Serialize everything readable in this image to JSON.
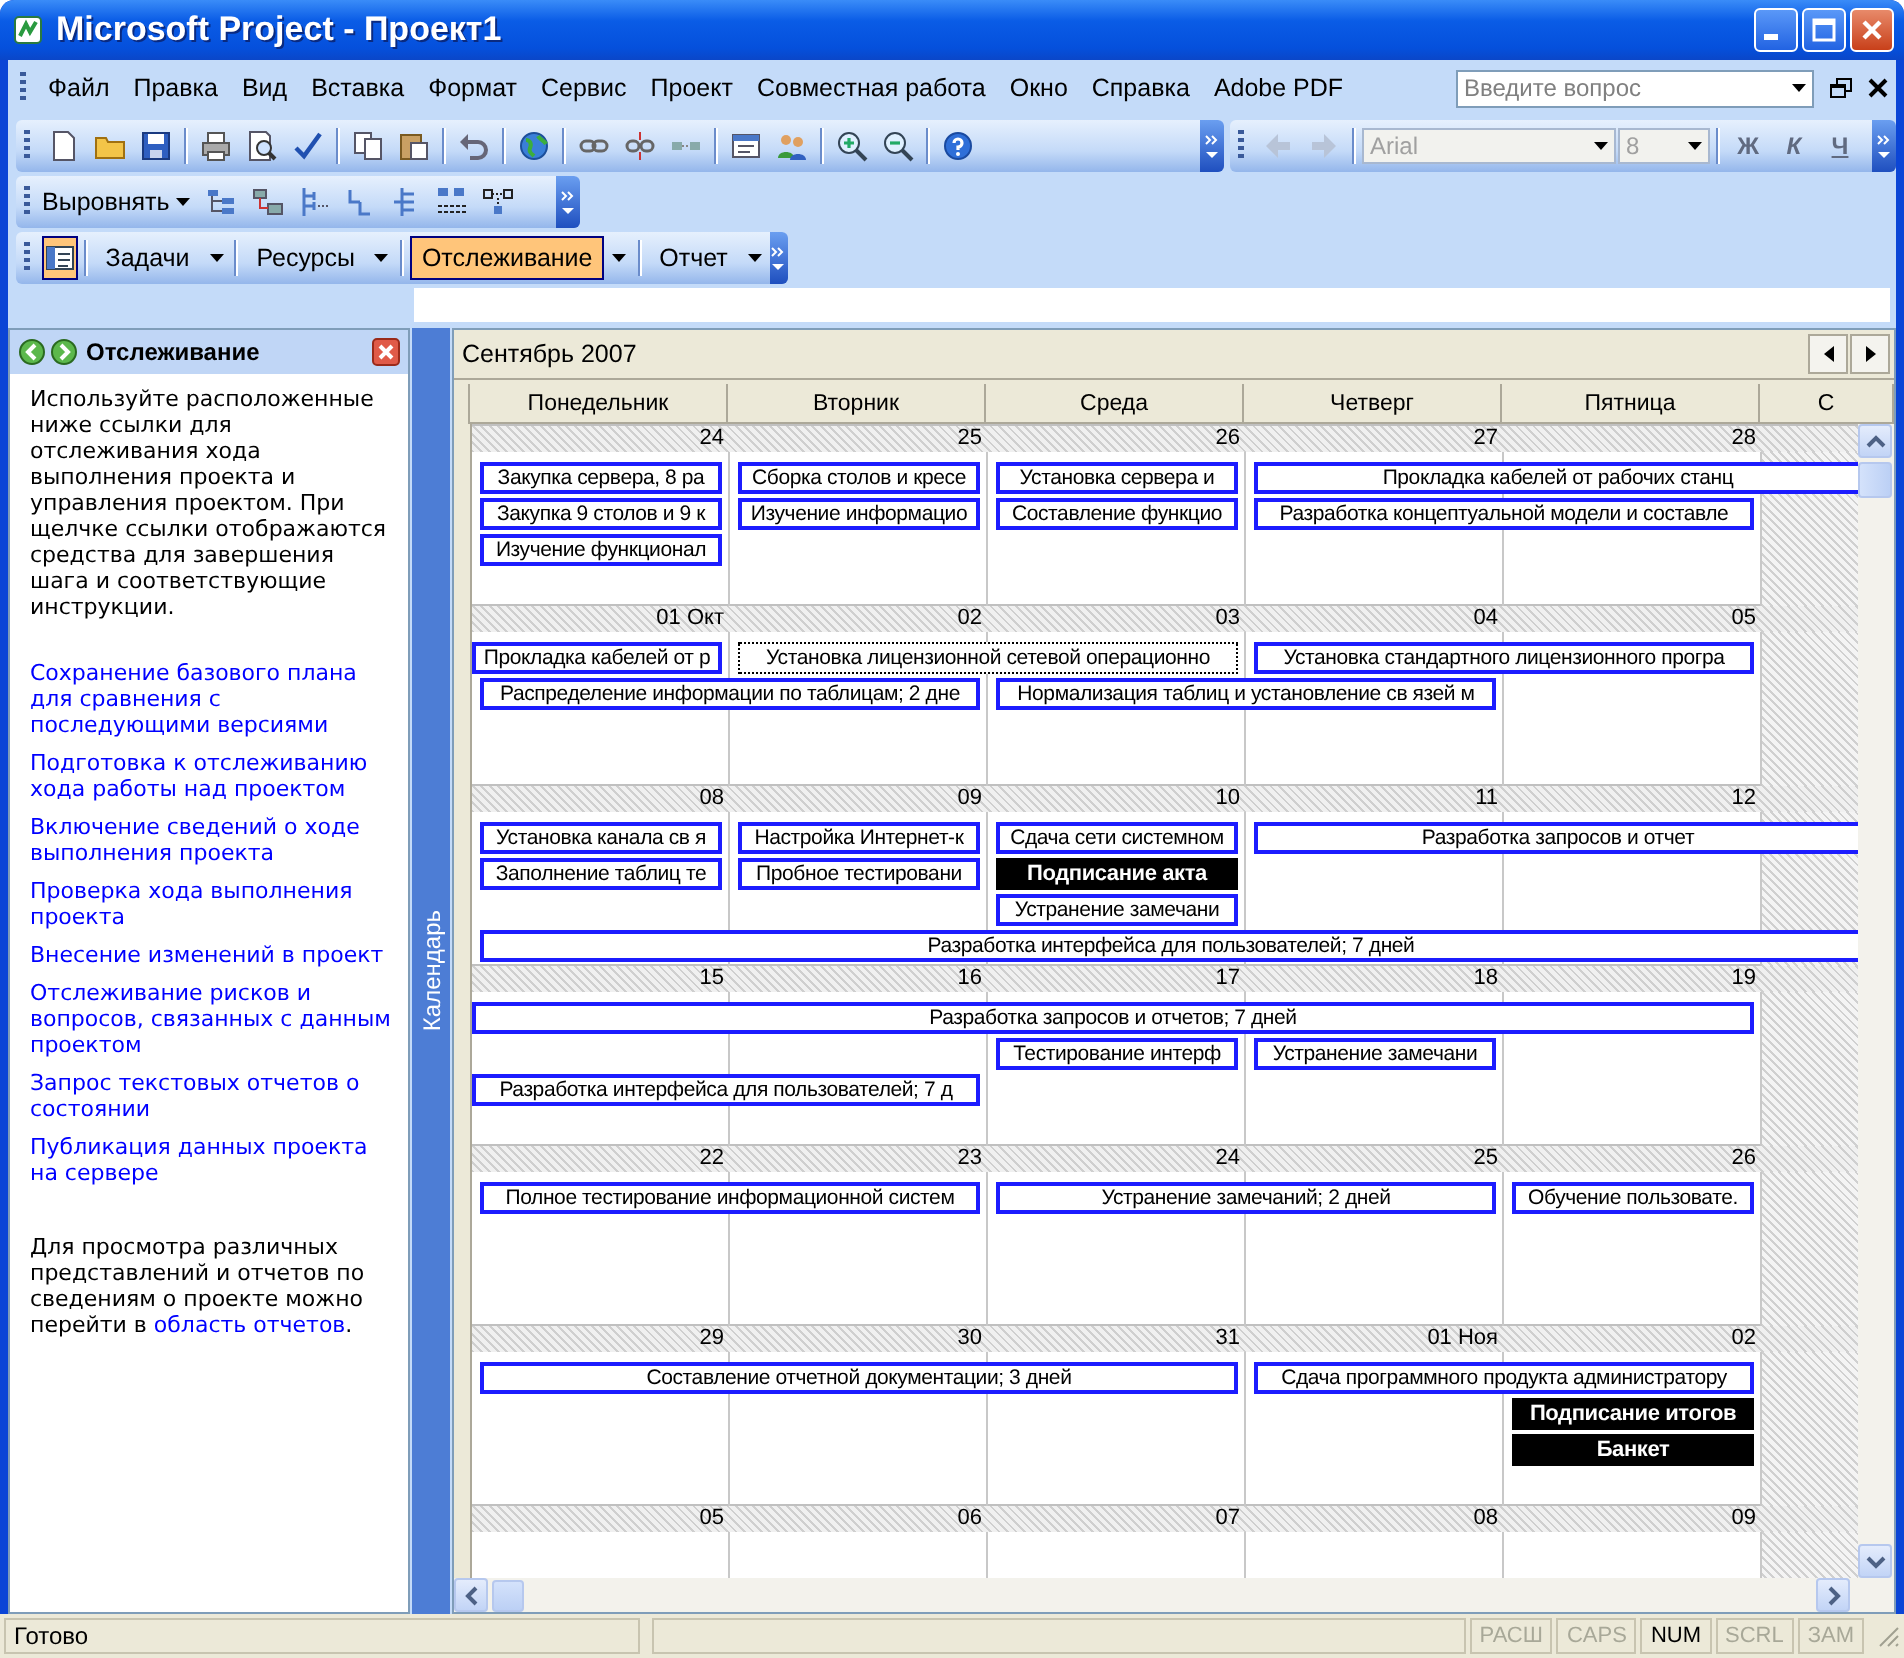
{
  "window": {
    "title": "Microsoft Project - Проект1"
  },
  "menu": [
    "Файл",
    "Правка",
    "Вид",
    "Вставка",
    "Формат",
    "Сервис",
    "Проект",
    "Совместная работа",
    "Окно",
    "Справка",
    "Adobe PDF"
  ],
  "ask_box": {
    "placeholder": "Введите вопрос"
  },
  "format_toolbar": {
    "font": "Arial",
    "size": "8",
    "buttons": [
      "Ж",
      "К",
      "Ч"
    ]
  },
  "align_toolbar": {
    "label": "Выровнять"
  },
  "project_guide": {
    "pane_button": {
      "on": true
    },
    "items": [
      {
        "label": "Задачи",
        "selected": false
      },
      {
        "label": "Ресурсы",
        "selected": false
      },
      {
        "label": "Отслеживание",
        "selected": true
      },
      {
        "label": "Отчет",
        "selected": false
      }
    ]
  },
  "task_pane": {
    "title": "Отслеживание",
    "intro": "Используйте расположенные ниже ссылки для отслеживания хода выполнения проекта и управления проектом. При щелчке ссылки отображаются средства для завершения шага и соответствующие инструкции.",
    "links": [
      "Сохранение базового плана для сравнения с последующими версиями",
      "Подготовка к отслеживанию хода работы над проектом",
      "Включение сведений о ходе выполнения проекта",
      "Проверка хода выполнения проекта",
      "Внесение изменений в проект",
      "Отслеживание рисков и вопросов, связанных с данным проектом",
      "Запрос текстовых отчетов о состоянии",
      "Публикация данных проекта на сервере"
    ],
    "footer": {
      "before": "Для просмотра различных представлений и отчетов по сведениям о проекте можно перейти в ",
      "link": "область отчетов",
      "after": "."
    }
  },
  "view_bar": {
    "label": "Календарь"
  },
  "calendar": {
    "month": "Сентябрь 2007",
    "weekdays": [
      "Понедельник",
      "Вторник",
      "Среда",
      "Четверг",
      "Пятница",
      "С"
    ],
    "weeks": [
      {
        "dates": [
          "24",
          "25",
          "26",
          "27",
          "28"
        ],
        "lanes": [
          [
            {
              "kind": "task",
              "text": "Закупка сервера, 8 ра",
              "selected": false
            },
            {
              "kind": "task",
              "text": "Сборка столов и кресе",
              "selected": false
            },
            {
              "kind": "task",
              "text": "Установка сервера и",
              "selected": false
            },
            {
              "kind": "task",
              "text": "Прокладка кабелей от рабочих станц",
              "selected": false
            },
            {
              "kind": "continued"
            },
            {
              "kind": "continued"
            }
          ],
          [
            {
              "kind": "task",
              "text": "Закупка 9 столов и 9 к",
              "selected": false
            },
            {
              "kind": "task",
              "text": "Изучение информацио",
              "selected": false
            },
            {
              "kind": "task",
              "text": "Составление функцио",
              "selected": false
            },
            {
              "kind": "task",
              "text": "Разработка концептуальной модели и составле",
              "selected": false
            },
            {
              "kind": "continued"
            }
          ],
          [
            {
              "kind": "task",
              "text": "Изучение функционал",
              "selected": false
            }
          ]
        ]
      },
      {
        "dates": [
          "01 Окт",
          "02",
          "03",
          "04",
          "05"
        ],
        "lanes": [
          [
            {
              "kind": "carried_task",
              "text": "Прокладка кабелей от р",
              "selected": false
            },
            {
              "kind": "task",
              "text": "Установка лицензионной сетевой операционно",
              "selected": true
            },
            {
              "kind": "continued"
            },
            {
              "kind": "task",
              "text": "Установка стандартного лицензионного програ",
              "selected": false
            },
            {
              "kind": "continued"
            }
          ],
          [
            {
              "kind": "task",
              "text": "Распределение информации по таблицам; 2 дне",
              "selected": false
            },
            {
              "kind": "continued"
            },
            {
              "kind": "task",
              "text": "Нормализация таблиц и установление св язей м",
              "selected": false
            },
            {
              "kind": "continued"
            }
          ]
        ]
      },
      {
        "dates": [
          "08",
          "09",
          "10",
          "11",
          "12"
        ],
        "lanes": [
          [
            {
              "kind": "task",
              "text": "Установка канала св я",
              "selected": false
            },
            {
              "kind": "task",
              "text": "Настройка Интернет-к",
              "selected": false
            },
            {
              "kind": "task",
              "text": "Сдача сети системном",
              "selected": false
            },
            {
              "kind": "task",
              "text": "Разработка запросов и отчет",
              "selected": false
            },
            {
              "kind": "continued"
            },
            {
              "kind": "continued"
            }
          ],
          [
            {
              "kind": "task",
              "text": "Заполнение таблиц те",
              "selected": false
            },
            {
              "kind": "task",
              "text": "Пробное тестировани",
              "selected": false
            },
            {
              "kind": "milestone",
              "text": "Подписание акта",
              "selected": false
            }
          ],
          [
            {
              "kind": "empty"
            },
            {
              "kind": "empty"
            },
            {
              "kind": "task",
              "text": "Устранение замечани",
              "selected": false
            }
          ],
          [
            {
              "kind": "task",
              "text": "Разработка интерфейса для пользователей; 7 дней",
              "selected": false
            },
            {
              "kind": "continued"
            },
            {
              "kind": "continued"
            },
            {
              "kind": "continued"
            },
            {
              "kind": "continued"
            },
            {
              "kind": "continued"
            }
          ]
        ]
      },
      {
        "dates": [
          "15",
          "16",
          "17",
          "18",
          "19"
        ],
        "lanes": [
          [
            {
              "kind": "carried_task",
              "text": "Разработка запросов и отчетов; 7 дней",
              "selected": false
            },
            {
              "kind": "continued"
            },
            {
              "kind": "continued"
            },
            {
              "kind": "continued"
            },
            {
              "kind": "continued"
            }
          ],
          [
            {
              "kind": "empty"
            },
            {
              "kind": "empty"
            },
            {
              "kind": "task",
              "text": "Тестирование интерф",
              "selected": false
            },
            {
              "kind": "task",
              "text": "Устранение замечани",
              "selected": false
            }
          ],
          [
            {
              "kind": "carried_task",
              "text": "Разработка интерфейса для пользователей; 7 д",
              "selected": false
            },
            {
              "kind": "continued"
            }
          ]
        ]
      },
      {
        "dates": [
          "22",
          "23",
          "24",
          "25",
          "26"
        ],
        "lanes": [
          [
            {
              "kind": "task",
              "text": "Полное тестирование информационной систем",
              "selected": false
            },
            {
              "kind": "continued"
            },
            {
              "kind": "task",
              "text": "Устранение замечаний; 2 дней",
              "selected": false
            },
            {
              "kind": "continued"
            },
            {
              "kind": "task",
              "text": "Обучение пользовате.",
              "selected": false
            }
          ]
        ]
      },
      {
        "dates": [
          "29",
          "30",
          "31",
          "01 Ноя",
          "02"
        ],
        "lanes": [
          [
            {
              "kind": "task",
              "text": "Составление отчетной документации; 3 дней",
              "selected": false
            },
            {
              "kind": "continued"
            },
            {
              "kind": "continued"
            },
            {
              "kind": "task",
              "text": "Сдача программного продукта администратору",
              "selected": false
            },
            {
              "kind": "continued"
            }
          ],
          [
            {
              "kind": "empty"
            },
            {
              "kind": "empty"
            },
            {
              "kind": "empty"
            },
            {
              "kind": "empty"
            },
            {
              "kind": "milestone",
              "text": "Подписание итогов",
              "selected": false
            }
          ],
          [
            {
              "kind": "empty"
            },
            {
              "kind": "empty"
            },
            {
              "kind": "empty"
            },
            {
              "kind": "empty"
            },
            {
              "kind": "milestone",
              "text": "Банкет",
              "selected": false
            }
          ]
        ]
      },
      {
        "dates": [
          "05",
          "06",
          "07",
          "08",
          "09"
        ]
      }
    ]
  },
  "status_bar": {
    "text": "Готово",
    "indicators": [
      {
        "label": "РАСШ",
        "on": false
      },
      {
        "label": "CAPS",
        "on": false
      },
      {
        "label": "NUM",
        "on": true
      },
      {
        "label": "SCRL",
        "on": false
      },
      {
        "label": "ЗАМ",
        "on": false
      }
    ]
  }
}
